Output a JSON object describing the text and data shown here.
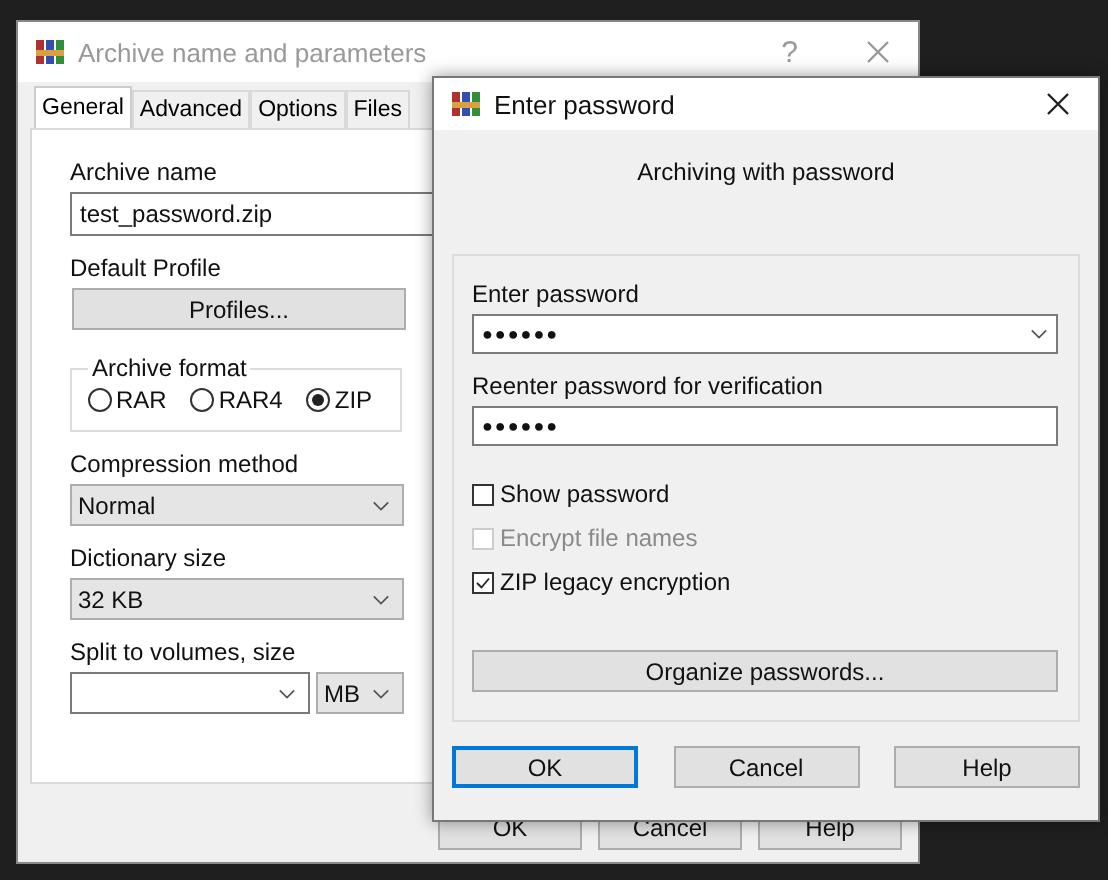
{
  "archive_window": {
    "title": "Archive name and parameters",
    "help_glyph": "?",
    "tabs": [
      {
        "label": "General",
        "selected": true
      },
      {
        "label": "Advanced",
        "selected": false
      },
      {
        "label": "Options",
        "selected": false
      },
      {
        "label": "Files",
        "selected": false
      }
    ],
    "archive_name_label": "Archive name",
    "archive_name": "test_password.zip",
    "profile_label": "Default Profile",
    "profiles_button": "Profiles...",
    "format_group": {
      "label": "Archive format",
      "options": [
        {
          "label": "RAR",
          "selected": false
        },
        {
          "label": "RAR4",
          "selected": false
        },
        {
          "label": "ZIP",
          "selected": true
        }
      ]
    },
    "compression": {
      "label": "Compression method",
      "value": "Normal"
    },
    "dictionary": {
      "label": "Dictionary size",
      "value": "32 KB"
    },
    "split": {
      "label": "Split to volumes, size",
      "unit": "MB"
    },
    "buttons": [
      "OK",
      "Cancel",
      "Help"
    ]
  },
  "password_dialog": {
    "title": "Enter password",
    "heading": "Archiving with password",
    "enter_label": "Enter password",
    "password_mask": "●●●●●●",
    "reenter_label": "Reenter password for verification",
    "reenter_mask": "●●●●●●",
    "checkboxes": [
      {
        "label": "Show password",
        "checked": false,
        "disabled": false
      },
      {
        "label": "Encrypt file names",
        "checked": false,
        "disabled": true
      },
      {
        "label": "ZIP legacy encryption",
        "checked": true,
        "disabled": false
      }
    ],
    "organize_button": "Organize passwords...",
    "buttons": [
      {
        "label": "OK",
        "default": true
      },
      {
        "label": "Cancel",
        "default": false
      },
      {
        "label": "Help",
        "default": false
      }
    ]
  }
}
